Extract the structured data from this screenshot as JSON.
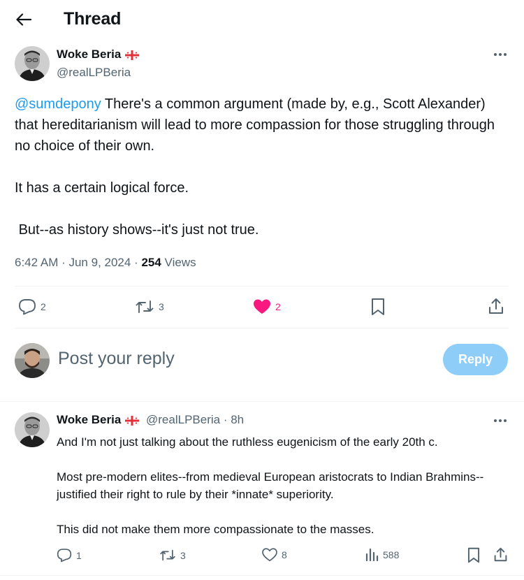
{
  "header": {
    "title": "Thread",
    "back_icon": "arrow-left-icon"
  },
  "tweet": {
    "author_name": "Woke Beria",
    "author_handle": "@realLPBeria",
    "mention": "@sumdepony",
    "paragraph1": " There's a common argument (made by, e.g., Scott Alexander) that hereditarianism will lead to more compassion for those struggling through no choice of their own.",
    "paragraph2": "It has a certain logical force.",
    "paragraph3": " But--as history shows--it's just not true.",
    "time": "6:42 AM · Jun 9, 2024 · ",
    "views_count": "254",
    "views_label": " Views",
    "replies": "2",
    "reposts": "3",
    "likes": "2"
  },
  "compose": {
    "placeholder": "Post your reply",
    "button_label": "Reply"
  },
  "reply": {
    "author_name": "Woke Beria",
    "handle_time": "@realLPBeria · 8h",
    "paragraph1": "And I'm not just talking about the ruthless eugenicism of the early 20th c.",
    "paragraph2": "Most pre-modern elites--from medieval European aristocrats to Indian Brahmins--justified their right to rule by their *innate* superiority.",
    "paragraph3": "This did not make them more compassionate to the masses.",
    "replies": "1",
    "reposts": "3",
    "likes": "8",
    "views": "588"
  },
  "colors": {
    "accent": "#1d9bf0",
    "like": "#f91880",
    "muted": "#536471",
    "reply_button": "#8ecdf8"
  }
}
